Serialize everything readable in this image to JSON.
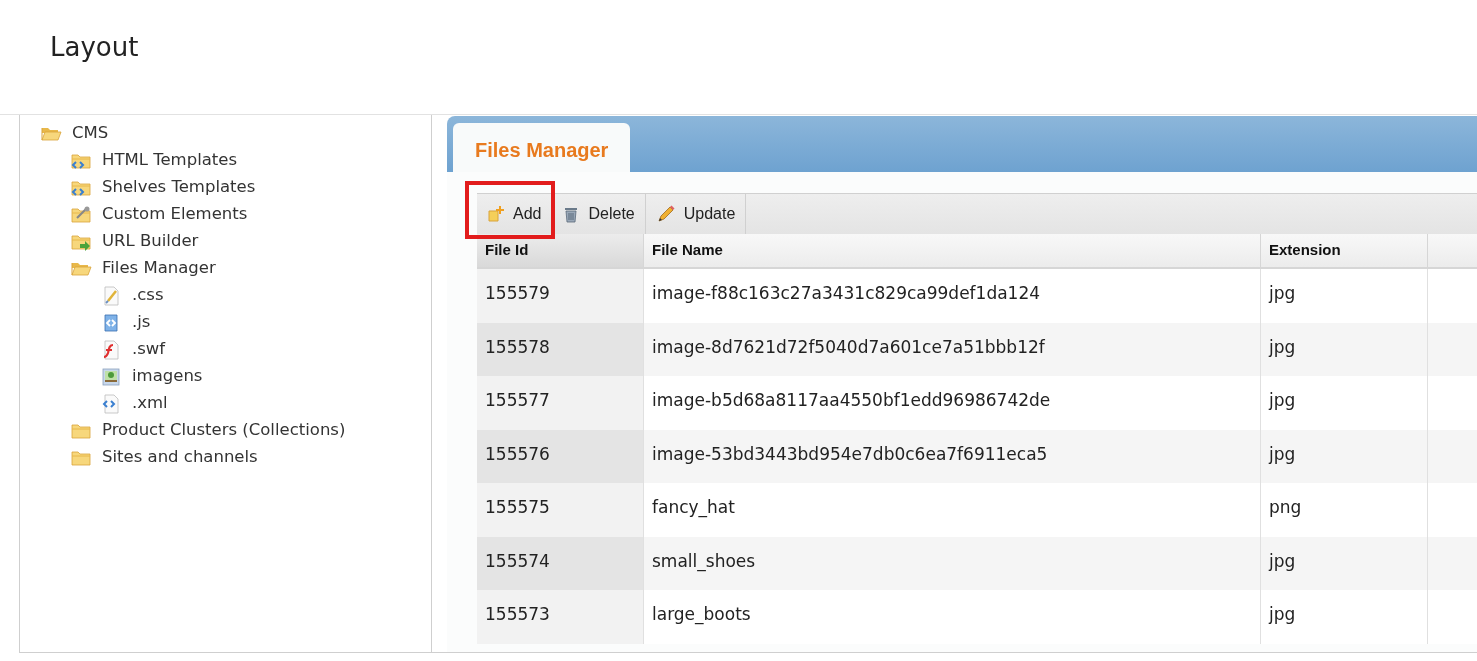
{
  "page_title": "Layout",
  "tree": [
    {
      "label": "CMS",
      "kind": "folder",
      "expanded": true,
      "children": [
        {
          "label": "HTML Templates",
          "kind": "code-folder"
        },
        {
          "label": "Shelves Templates",
          "kind": "code-folder"
        },
        {
          "label": "Custom Elements",
          "kind": "tool-folder"
        },
        {
          "label": "URL Builder",
          "kind": "arrow-folder"
        },
        {
          "label": "Files Manager",
          "kind": "folder",
          "expanded": true,
          "children": [
            {
              "label": ".css",
              "kind": "css"
            },
            {
              "label": ".js",
              "kind": "js"
            },
            {
              "label": ".swf",
              "kind": "swf"
            },
            {
              "label": "imagens",
              "kind": "image"
            },
            {
              "label": ".xml",
              "kind": "xml"
            }
          ]
        },
        {
          "label": "Product Clusters (Collections)",
          "kind": "folder",
          "expanded": false
        },
        {
          "label": "Sites and channels",
          "kind": "folder",
          "expanded": false
        }
      ]
    }
  ],
  "tab": {
    "label": "Files Manager",
    "selected": true
  },
  "toolbar": [
    {
      "label": "Add",
      "kind": "add",
      "highlighted": true
    },
    {
      "label": "Delete",
      "kind": "delete",
      "highlighted": false
    },
    {
      "label": "Update",
      "kind": "update",
      "highlighted": false
    }
  ],
  "table": {
    "columns": [
      "File Id",
      "File Name",
      "Extension"
    ],
    "rows": [
      [
        "155579",
        "image-f88c163c27a3431c829ca99def1da124",
        "jpg"
      ],
      [
        "155578",
        "image-8d7621d72f5040d7a601ce7a51bbb12f",
        "jpg"
      ],
      [
        "155577",
        "image-b5d68a8117aa4550bf1edd96986742de",
        "jpg"
      ],
      [
        "155576",
        "image-53bd3443bd954e7db0c6ea7f6911eca5",
        "jpg"
      ],
      [
        "155575",
        "fancy_hat",
        "png"
      ],
      [
        "155574",
        "small_shoes",
        "jpg"
      ],
      [
        "155573",
        "large_boots",
        "jpg"
      ]
    ]
  }
}
